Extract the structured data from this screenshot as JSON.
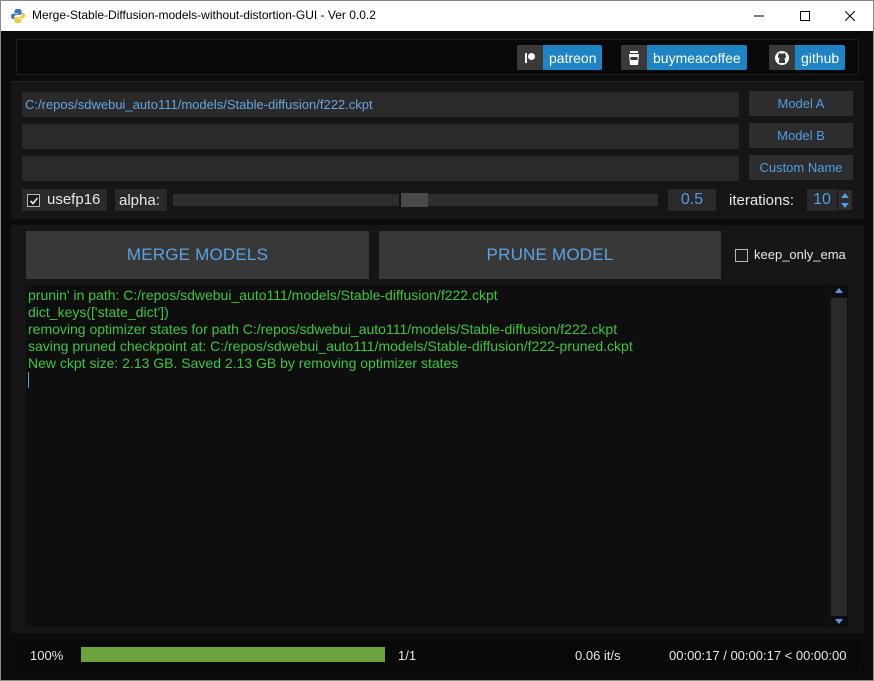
{
  "window": {
    "title": "Merge-Stable-Diffusion-models-without-distortion-GUI - Ver 0.0.2"
  },
  "links": [
    {
      "label": "patreon",
      "icon": "patreon-icon"
    },
    {
      "label": "buymeacoffee",
      "icon": "coffee-cup-icon"
    },
    {
      "label": "github",
      "icon": "github-icon"
    }
  ],
  "models": {
    "model_a_path": "C:/repos/sdwebui_auto111/models/Stable-diffusion/f222.ckpt",
    "model_b_path": "",
    "custom_name": "",
    "model_a_label": "Model A",
    "model_b_label": "Model B",
    "custom_name_label": "Custom Name"
  },
  "options": {
    "usefp16_label": "usefp16",
    "usefp16_checked": true,
    "alpha_label": "alpha:",
    "alpha_value": "0.5",
    "iterations_label": "iterations:",
    "iterations_value": "10"
  },
  "actions": {
    "merge_label": "MERGE MODELS",
    "prune_label": "PRUNE MODEL",
    "keep_only_ema_label": "keep_only_ema",
    "keep_only_ema_checked": false
  },
  "console": {
    "lines": [
      "prunin' in path: C:/repos/sdwebui_auto111/models/Stable-diffusion/f222.ckpt",
      "dict_keys(['state_dict'])",
      "removing optimizer states for path C:/repos/sdwebui_auto111/models/Stable-diffusion/f222.ckpt",
      "saving pruned checkpoint at: C:/repos/sdwebui_auto111/models/Stable-diffusion/f222-pruned.ckpt",
      "New ckpt size: 2.13 GB. Saved 2.13 GB by removing optimizer states"
    ]
  },
  "status": {
    "percent_text": "100%",
    "progress_fraction": 1.0,
    "count_text": "1/1",
    "rate_text": "0.06 it/s",
    "time_text": "00:00:17 / 00:00:17 < 00:00:00"
  },
  "colors": {
    "accent_blue": "#4f9ee6",
    "console_green": "#3ec53e",
    "progress_green": "#6aa33c",
    "badge_blue": "#1f84c4"
  }
}
